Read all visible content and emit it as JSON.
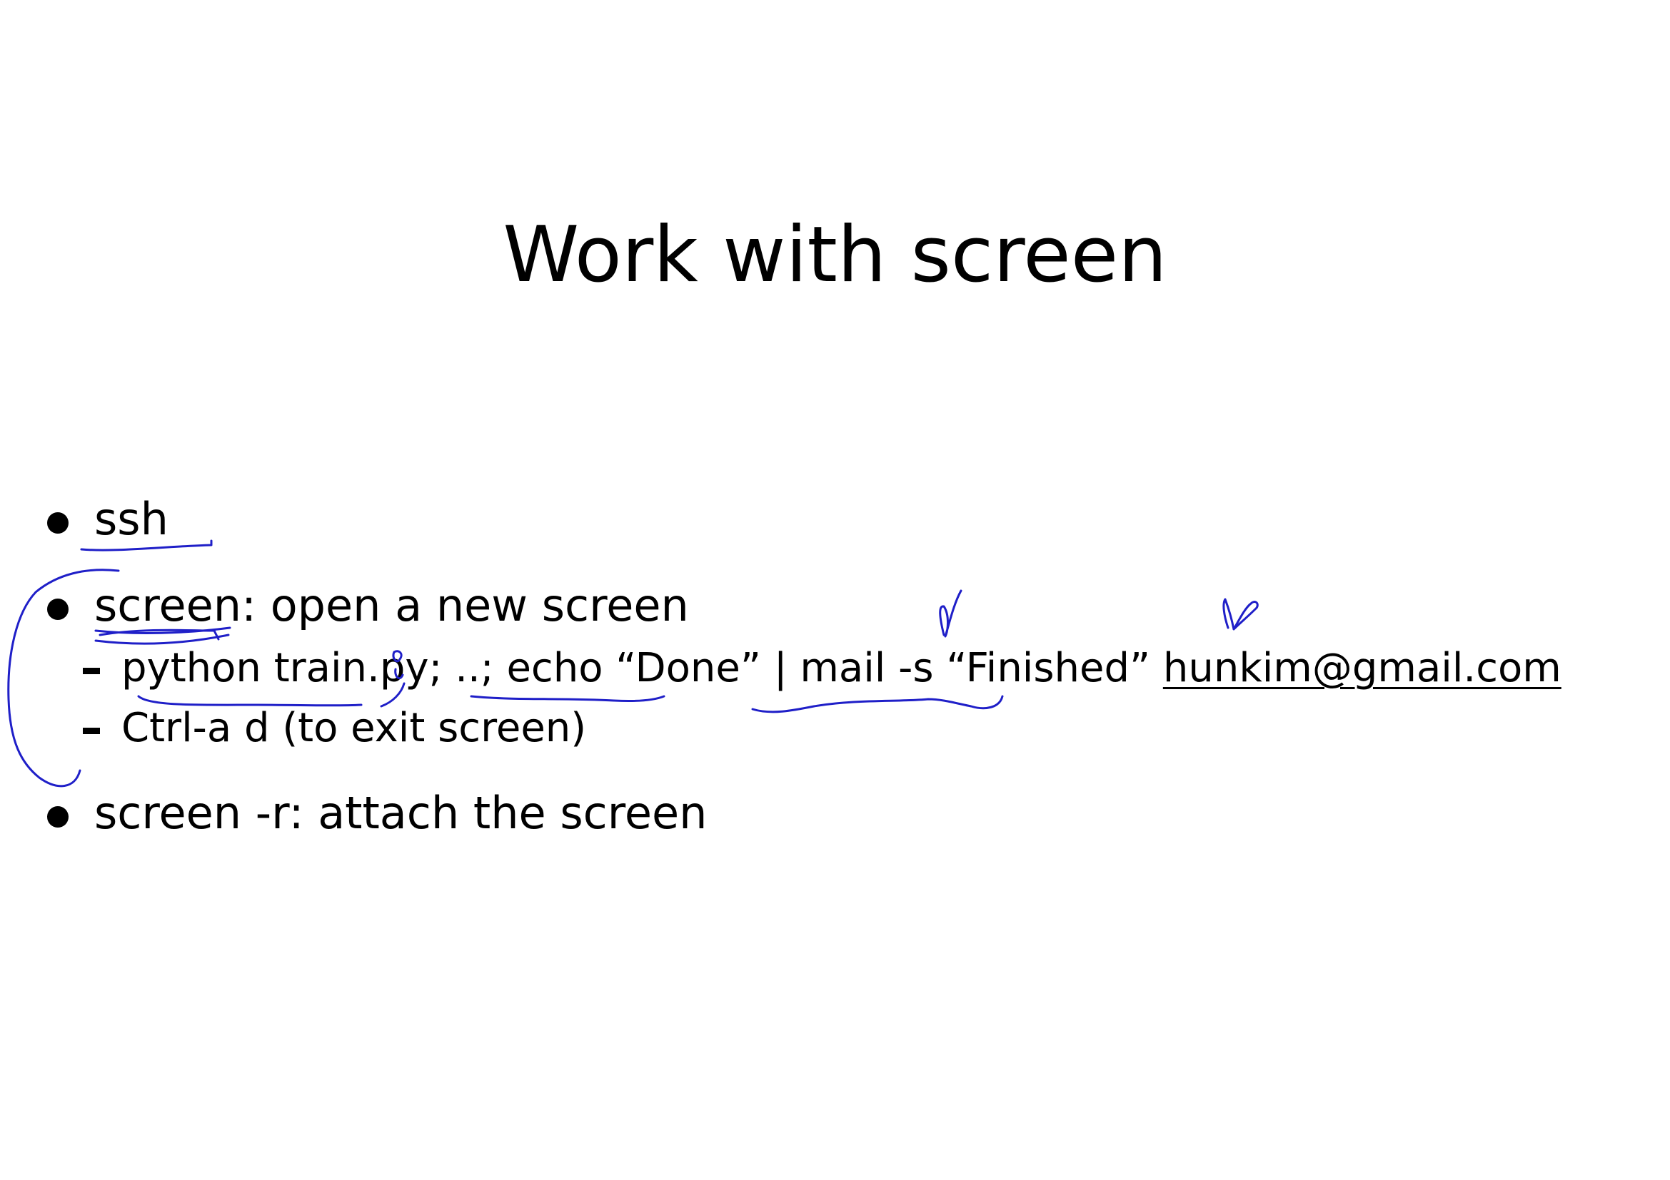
{
  "slide": {
    "title": "Work with screen",
    "bullets": [
      {
        "term": "ssh",
        "rest": ""
      },
      {
        "term": "screen:",
        "rest": " open a new screen"
      },
      {
        "term": "screen -r:",
        "rest": " attach the screen"
      }
    ],
    "subitems": [
      {
        "command": "python train.py; ..; echo “Done” | mail -s “Finished” ",
        "email": "hunkim@gmail.com"
      },
      {
        "command": "Ctrl-a d (to exit screen)"
      }
    ]
  },
  "colors": {
    "ink": "#1f1fc8",
    "text": "#000000",
    "background": "#ffffff"
  }
}
